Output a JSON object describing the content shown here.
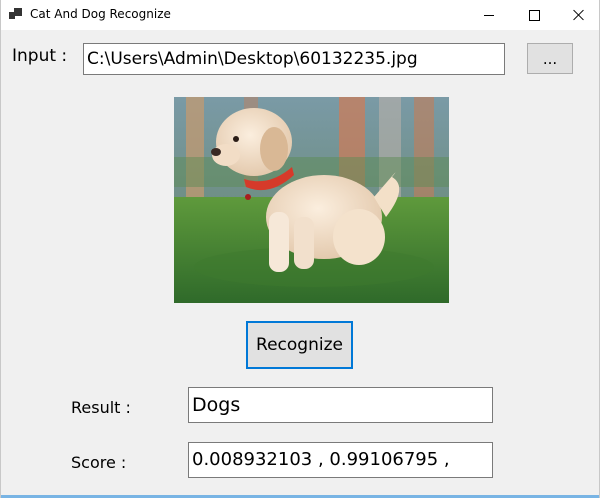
{
  "window": {
    "title": "Cat And Dog Recognize",
    "controls": [
      "minimize-icon",
      "maximize-icon",
      "close-icon"
    ]
  },
  "input": {
    "label": "Input :",
    "path": "C:\\Users\\Admin\\Desktop\\60132235.jpg",
    "browse_label": "..."
  },
  "image": {
    "subject": "puppy on grass"
  },
  "recognize": {
    "label": "Recognize"
  },
  "result": {
    "label": "Result :",
    "value": "Dogs"
  },
  "score": {
    "label": "Score :",
    "value": "0.008932103 , 0.99106795 ,"
  },
  "colors": {
    "window_bg": "#f0f0f0",
    "accent": "#0078d7",
    "button_bg": "#e1e1e1"
  }
}
